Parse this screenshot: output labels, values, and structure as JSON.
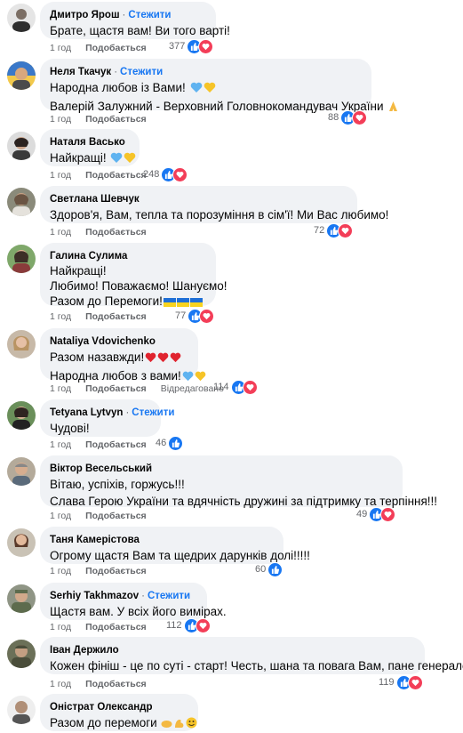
{
  "labels": {
    "like": "Подобається",
    "follow": "Стежити",
    "dot": "·"
  },
  "colors": {
    "link": "#1877f2",
    "bubble": "#f0f2f5",
    "like_icon": "#1877f2",
    "love_icon": "#f33e58"
  },
  "comments": [
    {
      "author": "Дмитро Ярош",
      "follow": true,
      "lines": [
        "Брате, щастя вам! Ви того варті!"
      ],
      "time": "1 год",
      "reactions": "377",
      "icons": [
        "like-icon",
        "love-icon"
      ]
    },
    {
      "author": "Неля Ткачук",
      "follow": true,
      "lines": [
        "Народна любов із Вами!",
        "Валерій Залужний - Верховний Головнокомандувач України"
      ],
      "line_emoji": [
        [
          "blue-heart-icon",
          "yellow-heart-icon"
        ],
        [
          "folded-hands-icon"
        ]
      ],
      "time": "1 год",
      "reactions": "88",
      "icons": [
        "like-icon",
        "love-icon"
      ]
    },
    {
      "author": "Наталя Васько",
      "follow": false,
      "lines": [
        "Найкращі!"
      ],
      "line_emoji": [
        [
          "blue-heart-icon",
          "yellow-heart-icon"
        ]
      ],
      "time": "1 год",
      "reactions": "248",
      "icons": [
        "like-icon",
        "love-icon"
      ]
    },
    {
      "author": "Светлана Шевчук",
      "follow": false,
      "lines": [
        "Здоров'я, Вам, тепла та порозуміння в сім'ї! Ми Вас любимо!"
      ],
      "time": "1 год",
      "reactions": "72",
      "icons": [
        "like-icon",
        "love-icon"
      ]
    },
    {
      "author": "Галина Сулима",
      "follow": false,
      "lines": [
        "Найкращі!",
        "Любимо! Поважаємо! Шануємо!",
        "Разом до Перемоги!"
      ],
      "line_emoji": [
        [],
        [],
        [
          "ukraine-flag-icon",
          "ukraine-flag-icon",
          "ukraine-flag-icon"
        ]
      ],
      "time": "1 год",
      "reactions": "77",
      "icons": [
        "like-icon",
        "love-icon"
      ]
    },
    {
      "author": "Nataliya Vdovichenko",
      "follow": false,
      "lines": [
        "Разом назавжди!",
        "Народна любов з вами!"
      ],
      "line_emoji": [
        [
          "red-heart-icon",
          "red-heart-icon",
          "red-heart-icon"
        ],
        [
          "blue-heart-icon",
          "yellow-heart-icon"
        ]
      ],
      "time": "1 год",
      "edited": "Відредаговано",
      "reactions": "114",
      "icons": [
        "like-icon",
        "love-icon"
      ]
    },
    {
      "author": "Tetyana Lytvyn",
      "follow": true,
      "lines": [
        "Чудові!"
      ],
      "time": "1 год",
      "reactions": "46",
      "icons": [
        "like-icon"
      ]
    },
    {
      "author": "Віктор Весельський",
      "follow": false,
      "lines": [
        "Вітаю, успіхів, горжусь!!!",
        "Слава Герою України та вдячність дружині за підтримку та терпіння!!!"
      ],
      "time": "1 год",
      "reactions": "49",
      "icons": [
        "like-icon",
        "love-icon"
      ]
    },
    {
      "author": "Таня Камерістова",
      "follow": false,
      "lines": [
        "Огрому щастя Вам та щедрих дарунків долі!!!!!"
      ],
      "time": "1 год",
      "reactions": "60",
      "icons": [
        "like-icon"
      ]
    },
    {
      "author": "Serhiy Takhmazov",
      "follow": true,
      "lines": [
        "Щастя вам. У всіх його вимірах."
      ],
      "time": "1 год",
      "reactions": "112",
      "icons": [
        "like-icon",
        "love-icon"
      ]
    },
    {
      "author": "Іван Держило",
      "follow": false,
      "lines": [
        "Кожен фініш - це по суті - старт! Честь, шана та повага Вам, пане генерале!"
      ],
      "time": "1 год",
      "reactions": "119",
      "icons": [
        "like-icon",
        "love-icon"
      ]
    },
    {
      "author": "Оністрат Олександр",
      "follow": false,
      "lines": [
        "Разом до перемоги"
      ],
      "line_emoji": [
        [
          "hands-icon",
          "muscle-icon",
          "smile-icon"
        ]
      ]
    }
  ]
}
